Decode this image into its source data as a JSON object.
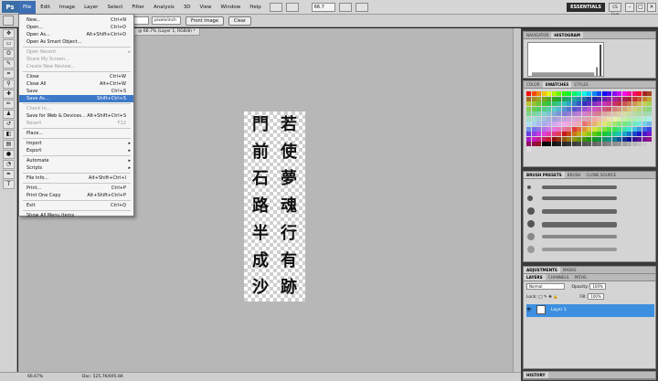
{
  "menubar": {
    "logo": "Ps",
    "items": [
      "File",
      "Edit",
      "Image",
      "Layer",
      "Select",
      "Filter",
      "Analysis",
      "3D",
      "View",
      "Window",
      "Help"
    ],
    "zoom": "66.7",
    "workspace": "ESSENTIALS",
    "cs_live": "CS Live"
  },
  "options": {
    "resolution_unit": "pixels/inch",
    "front_image_label": "Front Image",
    "clear_label": "Clear"
  },
  "document": {
    "tab_title": "@ 66.7% (Layer 1, RGB/8) *",
    "columns": [
      [
        "若",
        "使",
        "夢",
        "魂",
        "行",
        "有",
        "跡"
      ],
      [
        "門",
        "前",
        "石",
        "路",
        "半",
        "成",
        "沙"
      ]
    ]
  },
  "status": {
    "zoom": "66.67%",
    "doc_size": "Doc: 525.7K/695.6K"
  },
  "file_menu": [
    {
      "label": "New...",
      "shortcut": "Ctrl+N"
    },
    {
      "label": "Open...",
      "shortcut": "Ctrl+O"
    },
    {
      "label": "Open As...",
      "shortcut": "Alt+Shift+Ctrl+O"
    },
    {
      "label": "Open As Smart Object...",
      "shortcut": ""
    },
    {
      "label": "Open Recent",
      "shortcut": "",
      "submenu": true,
      "disabled": true
    },
    {
      "label": "Share My Screen...",
      "shortcut": "",
      "disabled": true
    },
    {
      "label": "Create New Review...",
      "shortcut": "",
      "disabled": true
    },
    {
      "label": "Close",
      "shortcut": "Ctrl+W"
    },
    {
      "label": "Close All",
      "shortcut": "Alt+Ctrl+W"
    },
    {
      "label": "Save",
      "shortcut": "Ctrl+S"
    },
    {
      "label": "Save As...",
      "shortcut": "Shift+Ctrl+S",
      "highlighted": true
    },
    {
      "label": "Check In...",
      "shortcut": "",
      "disabled": true
    },
    {
      "label": "Save for Web & Devices...",
      "shortcut": "Alt+Shift+Ctrl+S"
    },
    {
      "label": "Revert",
      "shortcut": "F12",
      "disabled": true
    },
    {
      "label": "Place...",
      "shortcut": ""
    },
    {
      "label": "Import",
      "shortcut": "",
      "submenu": true
    },
    {
      "label": "Export",
      "shortcut": "",
      "submenu": true
    },
    {
      "label": "Automate",
      "shortcut": "",
      "submenu": true
    },
    {
      "label": "Scripts",
      "shortcut": "",
      "submenu": true
    },
    {
      "label": "File Info...",
      "shortcut": "Alt+Shift+Ctrl+I"
    },
    {
      "label": "Print...",
      "shortcut": "Ctrl+P"
    },
    {
      "label": "Print One Copy",
      "shortcut": "Alt+Shift+Ctrl+P"
    },
    {
      "label": "Exit",
      "shortcut": "Ctrl+Q"
    },
    {
      "label": "Show All Menu Items",
      "shortcut": ""
    }
  ],
  "panels": {
    "navigator_tabs": [
      "NAVIGATOR",
      "HISTOGRAM"
    ],
    "color_tabs": [
      "COLOR",
      "SWATCHES",
      "STYLES"
    ],
    "brush_tabs": [
      "BRUSH PRESETS",
      "BRUSH",
      "CLONE SOURCE"
    ],
    "adjust_tabs": [
      "ADJUSTMENTS",
      "MASKS"
    ],
    "layer_tabs": [
      "LAYERS",
      "CHANNELS",
      "PATHS"
    ],
    "blend_mode": "Normal",
    "opacity_label": "Opacity:",
    "opacity_value": "100%",
    "lock_label": "Lock:",
    "fill_label": "Fill:",
    "fill_value": "100%",
    "layer_name": "Layer 1",
    "history_tab": "HISTORY"
  },
  "colors": {
    "highlight": "#3d79c9",
    "layer_selected": "#3d8fe0"
  }
}
